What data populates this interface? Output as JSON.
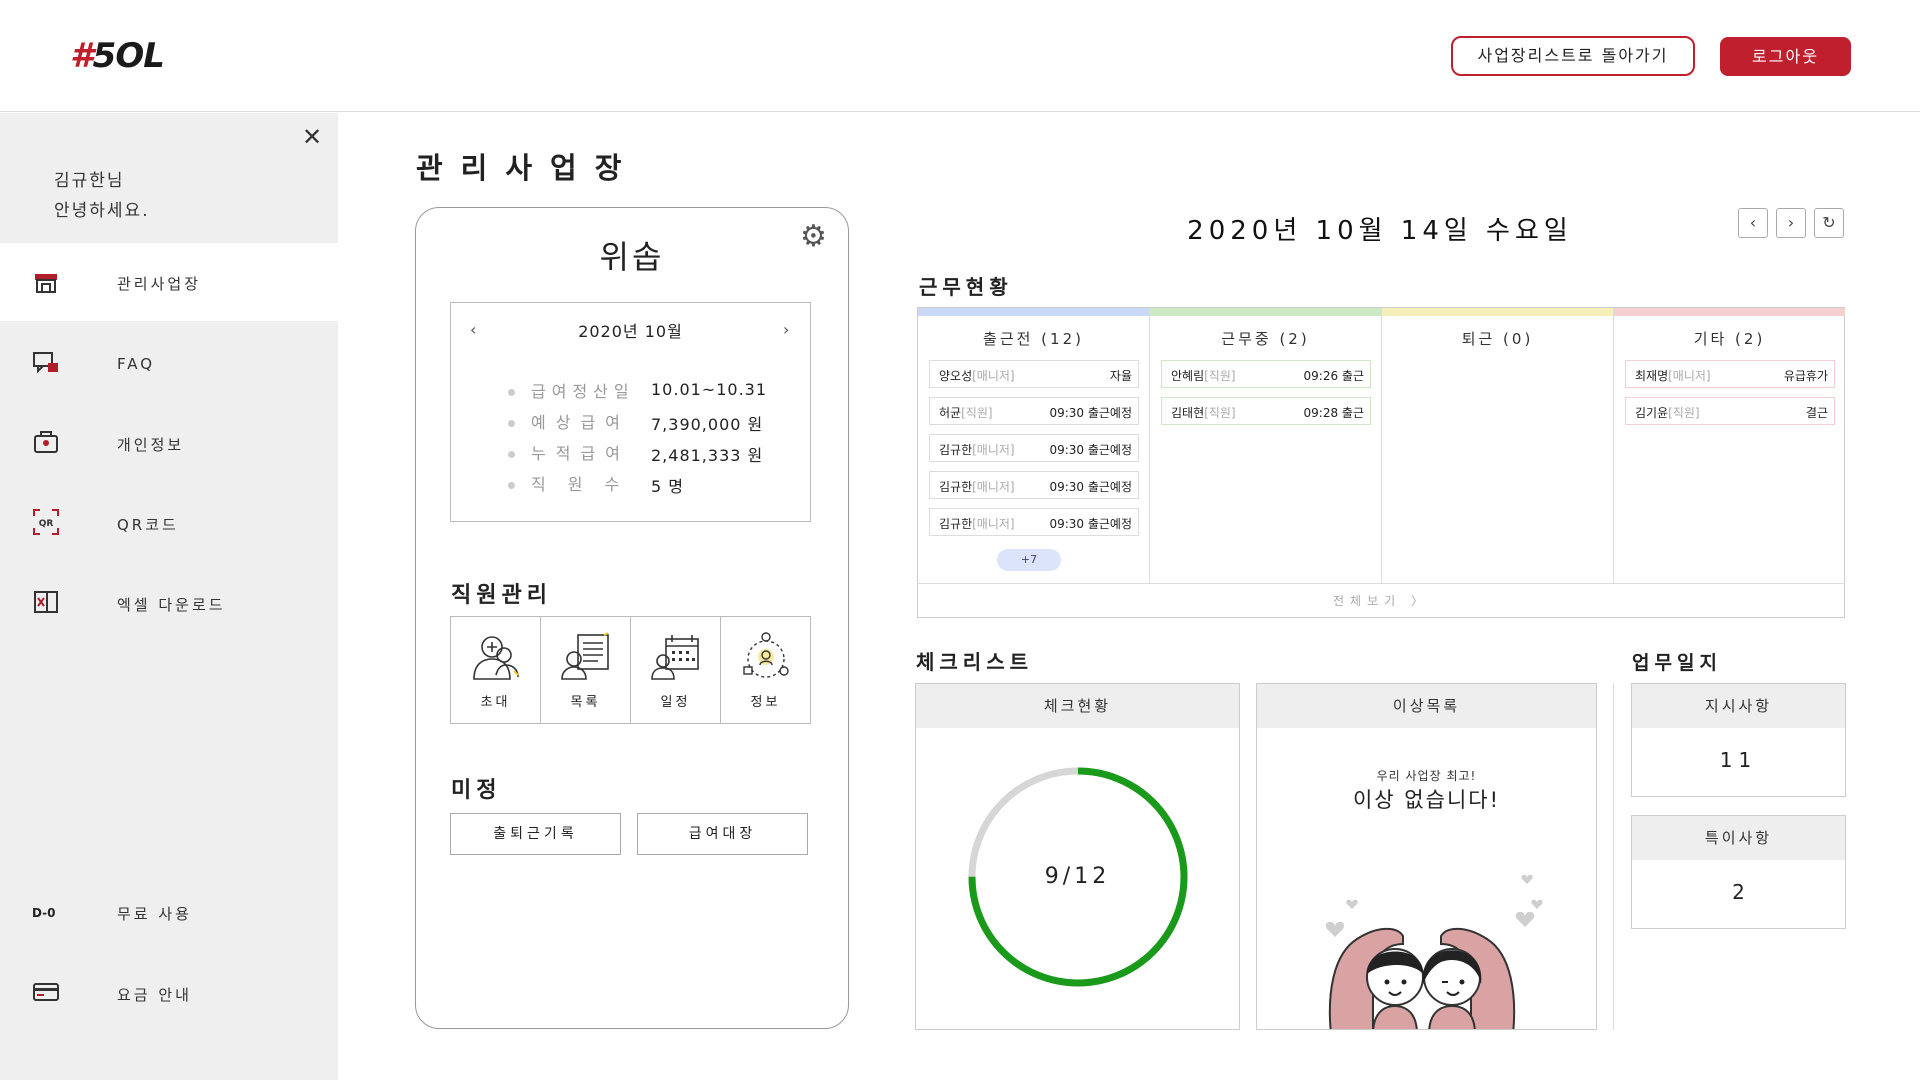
{
  "header": {
    "logo_hash": "#",
    "logo_text": "5OL",
    "back_label": "사업장리스트로 돌아가기",
    "logout_label": "로그아웃"
  },
  "sidebar": {
    "greeting_name": "김규한님",
    "greeting_text": "안녕하세요.",
    "items": [
      {
        "label": "관리사업장",
        "icon": "store-icon"
      },
      {
        "label": "FAQ",
        "icon": "chat-icon"
      },
      {
        "label": "개인정보",
        "icon": "lock-bag-icon"
      },
      {
        "label": "QR코드",
        "icon": "qr-icon"
      },
      {
        "label": "엑셀 다운로드",
        "icon": "excel-icon"
      },
      {
        "label": "무료 사용",
        "icon": "d-day-icon",
        "icon_text": "D-0"
      },
      {
        "label": "요금 안내",
        "icon": "card-icon"
      }
    ]
  },
  "page_title": "관리사업장",
  "store": {
    "name": "위솝",
    "month": "2020년 10월",
    "payroll": [
      {
        "label": "급여정산일",
        "value": "10.01~10.31"
      },
      {
        "label": "예상급여",
        "value": "7,390,000 원"
      },
      {
        "label": "누적급여",
        "value": "2,481,333 원"
      },
      {
        "label": "직원수",
        "value": "5 명"
      }
    ],
    "staff_title": "직원관리",
    "staff_actions": [
      "초대",
      "목록",
      "일정",
      "정보"
    ],
    "misc_title": "미정",
    "misc_buttons": [
      "출퇴근기록",
      "급여대장"
    ]
  },
  "date_title": "2020년 10월 14일 수요일",
  "attendance": {
    "title": "근무현황",
    "columns": [
      {
        "header": "출근전 (12)",
        "color": "#c9d8f6",
        "items": [
          {
            "name": "양오성",
            "role": "[매니저]",
            "status": "자율"
          },
          {
            "name": "허균",
            "role": "[직원]",
            "status": "09:30 출근예정"
          },
          {
            "name": "김규한",
            "role": "[매니저]",
            "status": "09:30 출근예정"
          },
          {
            "name": "김규한",
            "role": "[매니저]",
            "status": "09:30 출근예정"
          },
          {
            "name": "김규한",
            "role": "[매니저]",
            "status": "09:30 출근예정"
          }
        ],
        "more": "+7"
      },
      {
        "header": "근무중 (2)",
        "color": "#cde9c4",
        "items": [
          {
            "name": "안혜림",
            "role": "[직원]",
            "status": "09:26 출근"
          },
          {
            "name": "김태현",
            "role": "[직원]",
            "status": "09:28 출근"
          }
        ]
      },
      {
        "header": "퇴근 (0)",
        "color": "#f6efb8",
        "items": []
      },
      {
        "header": "기타 (2)",
        "color": "#f6cfd2",
        "items": [
          {
            "name": "최재명",
            "role": "[매니저]",
            "status": "유급휴가"
          },
          {
            "name": "김기윤",
            "role": "[직원]",
            "status": "결근"
          }
        ]
      }
    ],
    "view_all": "전체보기 〉"
  },
  "checklist": {
    "title": "체크리스트",
    "status_head": "체크현황",
    "done": 9,
    "total": 12,
    "ratio_text": "9/12",
    "issues_head": "이상목록",
    "issues_sub": "우리 사업장 최고!",
    "issues_main": "이상 없습니다!"
  },
  "worklog": {
    "title": "업무일지",
    "instructions_head": "지시사항",
    "instructions_count": "11",
    "notes_head": "특이사항",
    "notes_count": "2"
  },
  "colors": {
    "accent": "#c0202e",
    "progress": "#1a9a1a"
  }
}
